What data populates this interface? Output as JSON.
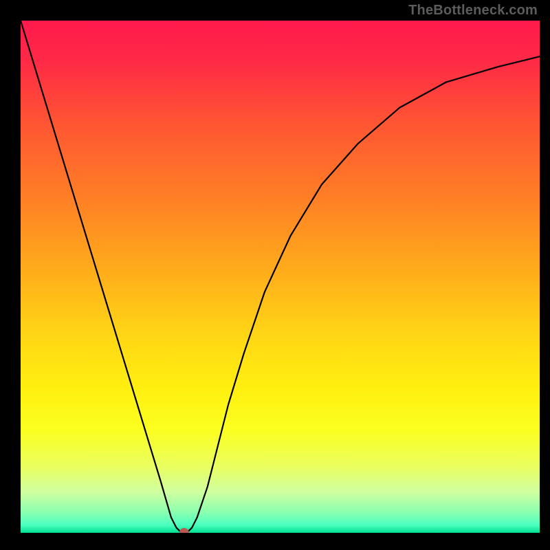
{
  "watermark": "TheBottleneck.com",
  "chart_data": {
    "type": "line",
    "title": "",
    "xlabel": "",
    "ylabel": "",
    "xlim": [
      0,
      100
    ],
    "ylim": [
      0,
      100
    ],
    "grid": false,
    "legend": false,
    "annotations": [],
    "gradient_stops": [
      {
        "offset": 0.0,
        "color": "#ff1a4d"
      },
      {
        "offset": 0.08,
        "color": "#ff2a46"
      },
      {
        "offset": 0.2,
        "color": "#ff5533"
      },
      {
        "offset": 0.35,
        "color": "#ff8025"
      },
      {
        "offset": 0.5,
        "color": "#ffb01a"
      },
      {
        "offset": 0.62,
        "color": "#ffd815"
      },
      {
        "offset": 0.72,
        "color": "#fff010"
      },
      {
        "offset": 0.8,
        "color": "#fbff20"
      },
      {
        "offset": 0.87,
        "color": "#eaff60"
      },
      {
        "offset": 0.92,
        "color": "#d0ffa0"
      },
      {
        "offset": 0.96,
        "color": "#8affb0"
      },
      {
        "offset": 0.985,
        "color": "#4affc0"
      },
      {
        "offset": 1.0,
        "color": "#00e090"
      }
    ],
    "series": [
      {
        "name": "curve",
        "stroke": "#000000",
        "stroke_width": 2.2,
        "x": [
          0,
          3,
          6,
          9,
          12,
          15,
          18,
          21,
          24,
          27,
          29,
          30,
          31,
          32,
          33,
          34,
          36,
          38,
          40,
          43,
          47,
          52,
          58,
          65,
          73,
          82,
          92,
          100
        ],
        "y": [
          100,
          90,
          80,
          70,
          60,
          50,
          40,
          30,
          20,
          10,
          3,
          1,
          0,
          0,
          1,
          3,
          9,
          17,
          25,
          35,
          47,
          58,
          68,
          76,
          83,
          88,
          91,
          93
        ]
      }
    ],
    "marker": {
      "x": 31.5,
      "y": 0,
      "color": "#b85a50",
      "radius": 7
    }
  }
}
